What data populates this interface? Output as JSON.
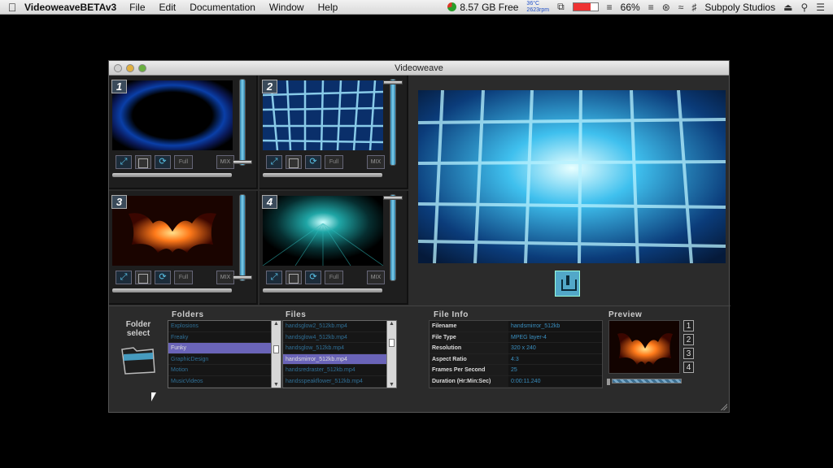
{
  "menubar": {
    "app_name": "VideoweaveBETAv3",
    "menus": [
      "File",
      "Edit",
      "Documentation",
      "Window",
      "Help"
    ],
    "disk_free": "8.57 GB Free",
    "temp": "36°C",
    "rpm": "2623rpm",
    "battery": "66%",
    "user": "Subpoly Studios"
  },
  "window": {
    "title": "Videoweave"
  },
  "channels": [
    {
      "number": "1",
      "full_label": "Full",
      "mix_label": "MIX",
      "fader_level": 0.02
    },
    {
      "number": "2",
      "full_label": "Full",
      "mix_label": "MIX",
      "fader_level": 0.98
    },
    {
      "number": "3",
      "full_label": "Full",
      "mix_label": "MIX",
      "fader_level": 0.02
    },
    {
      "number": "4",
      "full_label": "Full",
      "mix_label": "MIX",
      "fader_level": 0.98
    }
  ],
  "folder_select": {
    "line1": "Folder",
    "line2": "select"
  },
  "folders": {
    "header": "Folders",
    "items": [
      "Explosions",
      "Freaky",
      "Funky",
      "GraphicDesign",
      "Motion",
      "MusicVideos"
    ],
    "selected": 2
  },
  "files": {
    "header": "Files",
    "items": [
      "handsglow2_512kb.mp4",
      "handsglow4_512kb.mp4",
      "handsglow_512kb.mp4",
      "handsmirror_512kb.mp4",
      "handsredraster_512kb.mp4",
      "handsspeakflower_512kb.mp4"
    ],
    "selected": 3
  },
  "file_info": {
    "header": "File Info",
    "rows": [
      {
        "key": "Filename",
        "value": "handsmirror_512kb"
      },
      {
        "key": "File Type",
        "value": "MPEG layer-4"
      },
      {
        "key": "Resolution",
        "value": "320 x 240"
      },
      {
        "key": "Aspect Ratio",
        "value": "4:3"
      },
      {
        "key": "Frames Per Second",
        "value": "25"
      },
      {
        "key": "Duration (Hr:Min:Sec)",
        "value": "0:00:11.240"
      }
    ]
  },
  "preview": {
    "header": "Preview",
    "channel_buttons": [
      "1",
      "2",
      "3",
      "4"
    ]
  }
}
